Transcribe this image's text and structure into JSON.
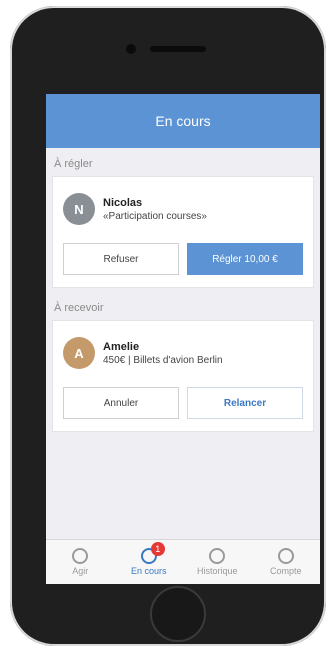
{
  "header": {
    "title": "En cours"
  },
  "sections": [
    {
      "title": "À régler",
      "person": {
        "name": "Nicolas",
        "initial": "N",
        "description": "«Participation courses»"
      },
      "buttons": {
        "secondary": "Refuser",
        "primary": "Régler 10,00 €"
      }
    },
    {
      "title": "À recevoir",
      "person": {
        "name": "Amelie",
        "initial": "A",
        "description": "450€ | Billets d'avion Berlin"
      },
      "buttons": {
        "secondary": "Annuler",
        "primary": "Relancer"
      }
    }
  ],
  "tabbar": {
    "items": [
      {
        "label": "Agir",
        "icon": "action-icon"
      },
      {
        "label": "En cours",
        "icon": "clock-icon",
        "badge": "1",
        "active": true
      },
      {
        "label": "Historique",
        "icon": "history-icon"
      },
      {
        "label": "Compte",
        "icon": "account-icon"
      }
    ]
  },
  "colors": {
    "accent": "#5b93d4",
    "badge": "#e53935"
  }
}
